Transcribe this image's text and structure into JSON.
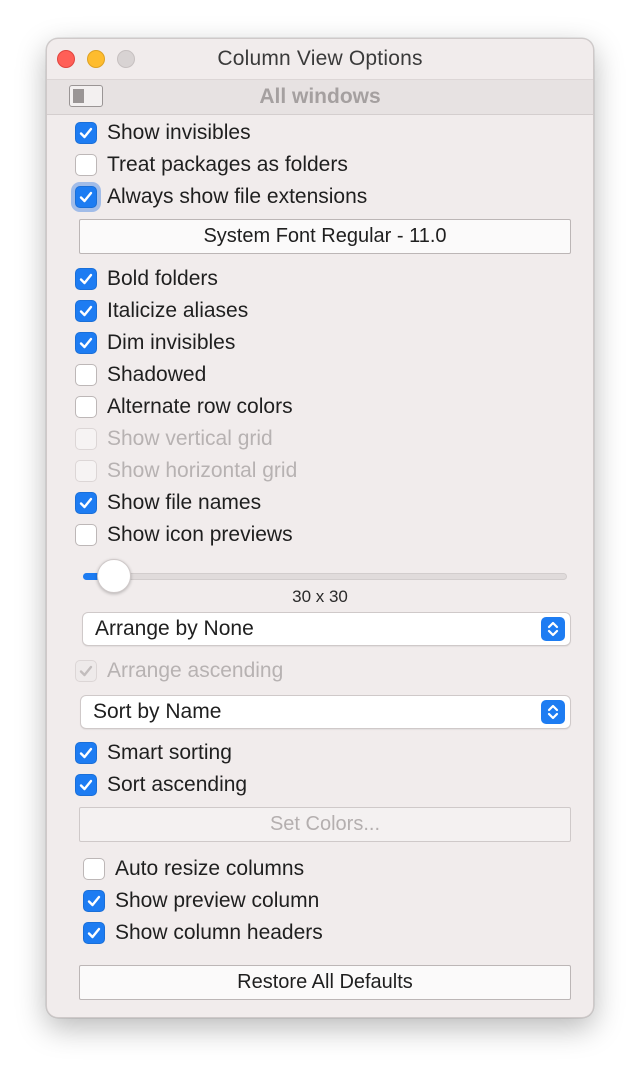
{
  "window": {
    "title": "Column View Options"
  },
  "scope": {
    "label": "All windows"
  },
  "options_top": [
    {
      "label": "Show invisibles",
      "checked": true
    },
    {
      "label": "Treat packages as folders",
      "checked": false
    },
    {
      "label": "Always show file extensions",
      "checked": true
    }
  ],
  "font_button": {
    "label": "System Font Regular - 11.0"
  },
  "options_style": [
    {
      "label": "Bold folders",
      "checked": true
    },
    {
      "label": "Italicize aliases",
      "checked": true
    },
    {
      "label": "Dim invisibles",
      "checked": true
    },
    {
      "label": "Shadowed",
      "checked": false
    },
    {
      "label": "Alternate row colors",
      "checked": false
    },
    {
      "label": "Show vertical grid",
      "checked": false
    },
    {
      "label": "Show horizontal grid",
      "checked": false
    },
    {
      "label": "Show file names",
      "checked": true
    },
    {
      "label": "Show icon previews",
      "checked": false
    }
  ],
  "icon_size": {
    "value_label": "30 x 30"
  },
  "arrange": {
    "selected": "Arrange by None",
    "ascending_label": "Arrange ascending",
    "ascending_checked": true
  },
  "sort": {
    "selected": "Sort by Name"
  },
  "options_sort": [
    {
      "label": "Smart sorting",
      "checked": true
    },
    {
      "label": "Sort ascending",
      "checked": true
    }
  ],
  "set_colors_button": {
    "label": "Set Colors..."
  },
  "options_columns": [
    {
      "label": "Auto resize columns",
      "checked": false
    },
    {
      "label": "Show preview column",
      "checked": true
    },
    {
      "label": "Show column headers",
      "checked": true
    }
  ],
  "restore_button": {
    "label": "Restore All Defaults"
  },
  "colors": {
    "accent": "#1d7cf2",
    "window_bg": "#f1ecec"
  }
}
